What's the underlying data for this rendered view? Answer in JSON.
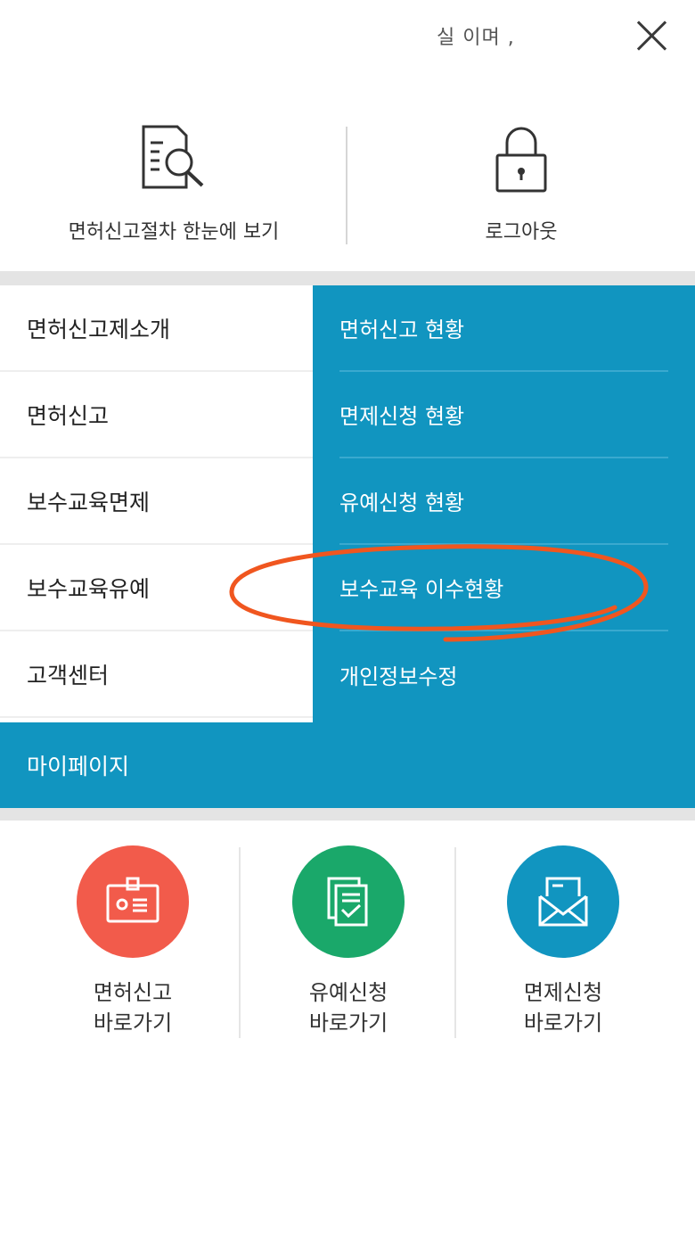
{
  "header": {
    "partial_text": "실 이며 ,",
    "close_icon": "close-icon"
  },
  "quick_links": [
    {
      "label": "면허신고절차 한눈에 보기",
      "icon": "document-search-icon"
    },
    {
      "label": "로그아웃",
      "icon": "lock-icon"
    }
  ],
  "menu_left": [
    {
      "label": "면허신고제소개"
    },
    {
      "label": "면허신고"
    },
    {
      "label": "보수교육면제"
    },
    {
      "label": "보수교육유예"
    },
    {
      "label": "고객센터"
    }
  ],
  "menu_right": [
    {
      "label": "면허신고 현황"
    },
    {
      "label": "면제신청 현황"
    },
    {
      "label": "유예신청 현황"
    },
    {
      "label": "보수교육 이수현황"
    },
    {
      "label": "개인정보수정"
    }
  ],
  "mypage": {
    "label": "마이페이지"
  },
  "shortcuts": [
    {
      "line1": "면허신고",
      "line2": "바로가기",
      "icon": "id-card-icon",
      "color": "#f25b4b"
    },
    {
      "line1": "유예신청",
      "line2": "바로가기",
      "icon": "document-check-icon",
      "color": "#1aa86a"
    },
    {
      "line1": "면제신청",
      "line2": "바로가기",
      "icon": "envelope-icon",
      "color": "#1195c0"
    }
  ],
  "colors": {
    "accent_blue": "#1195c0",
    "annotation_orange": "#f0561f"
  }
}
